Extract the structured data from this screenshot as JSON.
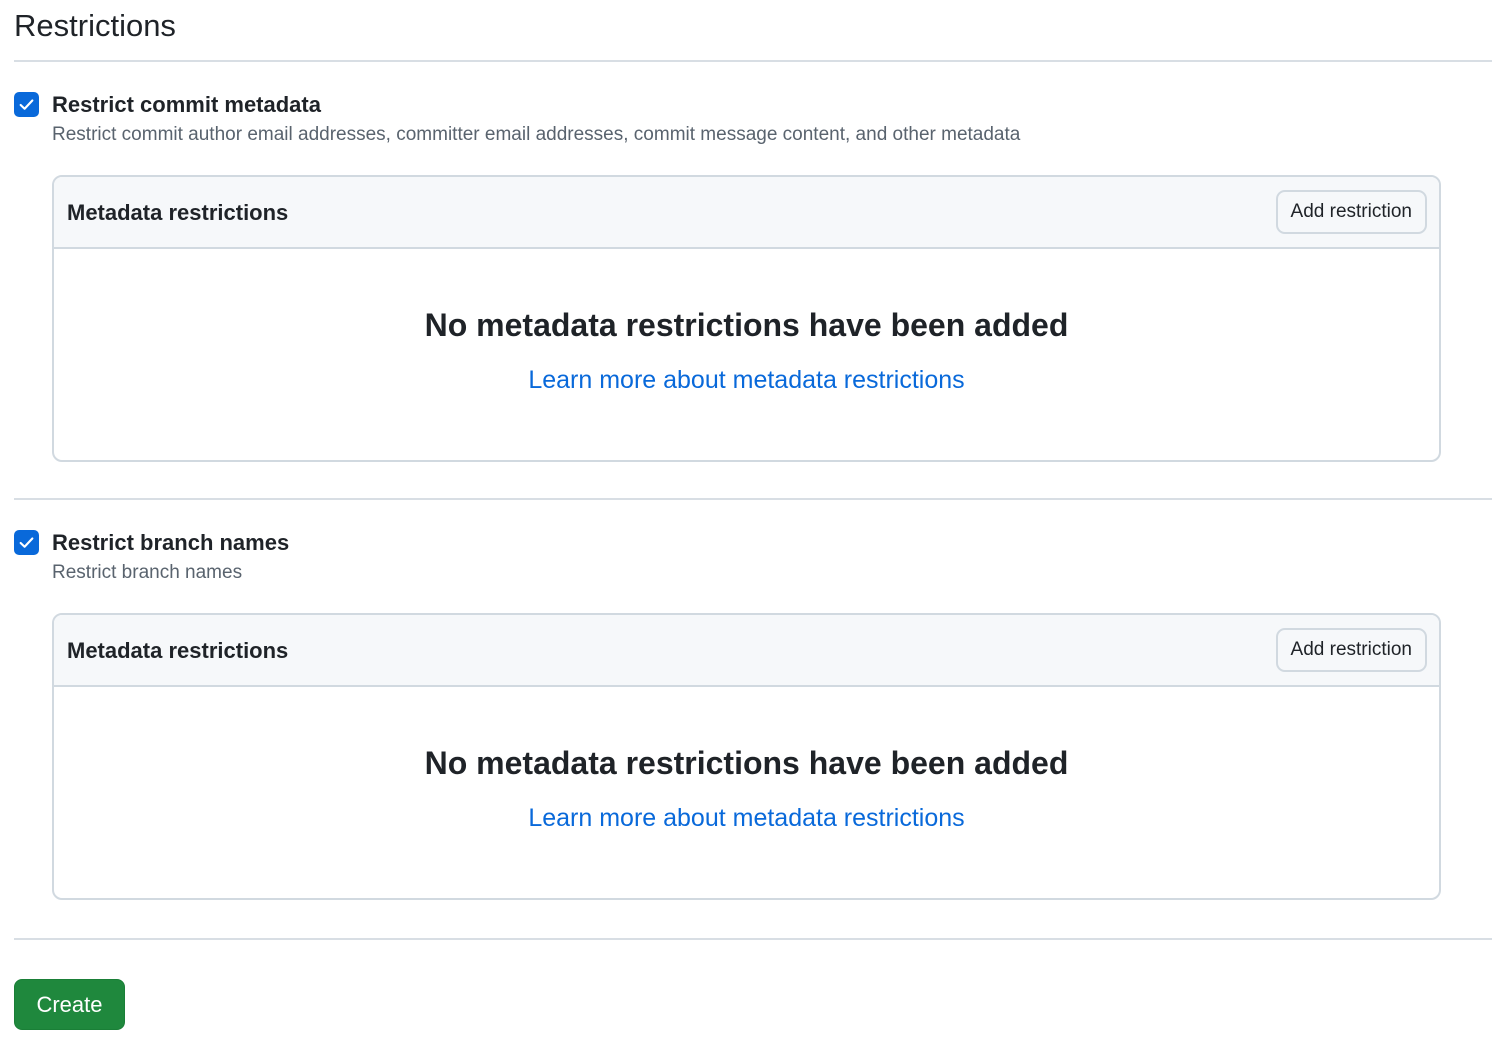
{
  "header": {
    "title": "Restrictions"
  },
  "rules": [
    {
      "label": "Restrict commit metadata",
      "description": "Restrict commit author email addresses, committer email addresses, commit message content, and other metadata",
      "checked": true,
      "box": {
        "title": "Metadata restrictions",
        "add_button_label": "Add restriction",
        "empty_title": "No metadata restrictions have been added",
        "learn_more_link": "Learn more about metadata restrictions"
      }
    },
    {
      "label": "Restrict branch names",
      "description": "Restrict branch names",
      "checked": true,
      "box": {
        "title": "Metadata restrictions",
        "add_button_label": "Add restriction",
        "empty_title": "No metadata restrictions have been added",
        "learn_more_link": "Learn more about metadata restrictions"
      }
    }
  ],
  "footer": {
    "create_label": "Create"
  },
  "colors": {
    "accent": "#0969da",
    "primary_button": "#1f883d",
    "border": "#d1d9e0",
    "muted_text": "#59636e"
  }
}
